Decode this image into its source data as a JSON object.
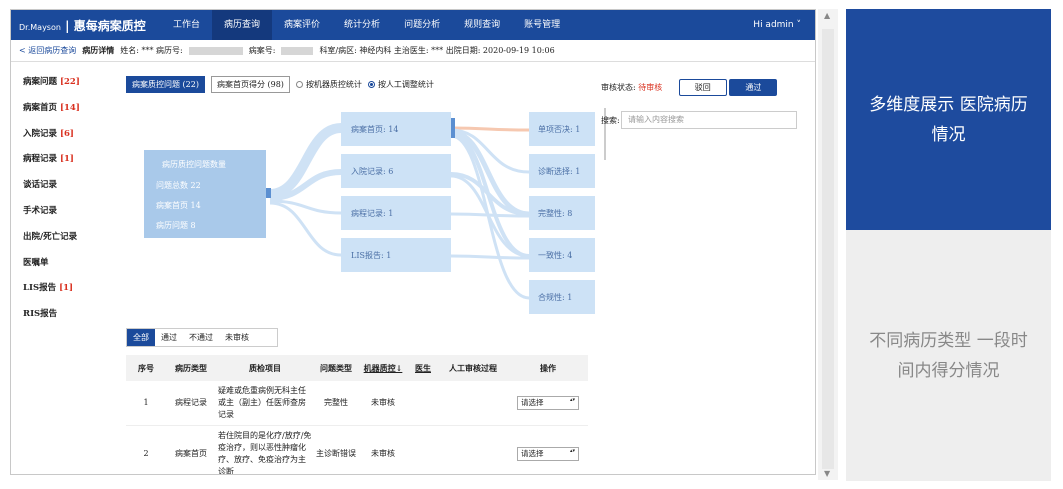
{
  "topnav": {
    "logo_brand": "Dr.Mayson",
    "logo_name": "惠每病案质控",
    "items": [
      "工作台",
      "病历查询",
      "病案评价",
      "统计分析",
      "问题分析",
      "规则查询",
      "账号管理"
    ],
    "user": "Hi admin ˅"
  },
  "infobar": {
    "back": "< 返回病历查询",
    "title": "病历详情",
    "name": "姓名: *** 病历号:",
    "case_no": "病案号:",
    "dept": "科室/病区: 神经内科 主治医生: *** 出院日期: 2020-09-19 10:06"
  },
  "sidebar": [
    {
      "label": "病案问题",
      "count": "[22]"
    },
    {
      "label": "病案首页",
      "count": "[14]"
    },
    {
      "label": "入院记录",
      "count": "[6]"
    },
    {
      "label": "病程记录",
      "count": "[1]"
    },
    {
      "label": "谈话记录",
      "count": ""
    },
    {
      "label": "手术记录",
      "count": ""
    },
    {
      "label": "出院/死亡记录",
      "count": ""
    },
    {
      "label": "医嘱单",
      "count": ""
    },
    {
      "label": "LIS报告",
      "count": "[1]"
    },
    {
      "label": "RIS报告",
      "count": ""
    }
  ],
  "tabs": {
    "qc_problems": "病案质控问题 (22)",
    "homepage_score": "病案首页得分 (98)",
    "machine_stats": "按机器质控统计",
    "manual_stats": "按人工调整统计"
  },
  "sankey": {
    "source": {
      "title": "病历质控问题数量",
      "lines": [
        "问题总数  22",
        "病案首页  14",
        "病历问题  8"
      ]
    },
    "middle": [
      "病案首页: 14",
      "入院记录: 6",
      "病程记录: 1",
      "LIS报告: 1"
    ],
    "right": [
      "单项否决: 1",
      "诊断选择: 1",
      "完整性: 8",
      "一致性: 4",
      "合规性: 1"
    ]
  },
  "review": {
    "label": "审核状态:",
    "status": "待审核",
    "reject": "驳回",
    "approve": "通过",
    "search_label": "搜索:",
    "search_placeholder": "请输入内容搜索"
  },
  "subtabs": [
    "全部",
    "通过",
    "不通过",
    "未审核"
  ],
  "table": {
    "headers": [
      "序号",
      "病历类型",
      "质检项目",
      "问题类型",
      "机器质控↓",
      "医生",
      "人工审核过程",
      "操作"
    ],
    "rows": [
      {
        "no": "1",
        "type": "病程记录",
        "item": "疑难或危重病例无科主任或主（副主）任医师查房记录",
        "issue": "完整性",
        "machine": "未审核",
        "doctor": "",
        "process": "",
        "action": "请选择"
      },
      {
        "no": "2",
        "type": "病案首页",
        "item": "若住院目的是化疗/放疗/免疫治疗，则以恶性肿瘤化疗、放疗、免疫治疗为主诊断",
        "issue": "主诊断错误",
        "machine": "未审核",
        "doctor": "",
        "process": "",
        "action": "请选择"
      }
    ]
  },
  "panels": {
    "blue": "多维度展示 医院病历情况",
    "grey": "不同病历类型 一段时间内得分情况"
  },
  "colors": {
    "brand": "#1b4a9b",
    "node": "#a9c9ea",
    "accent_red": "#d9301f"
  }
}
